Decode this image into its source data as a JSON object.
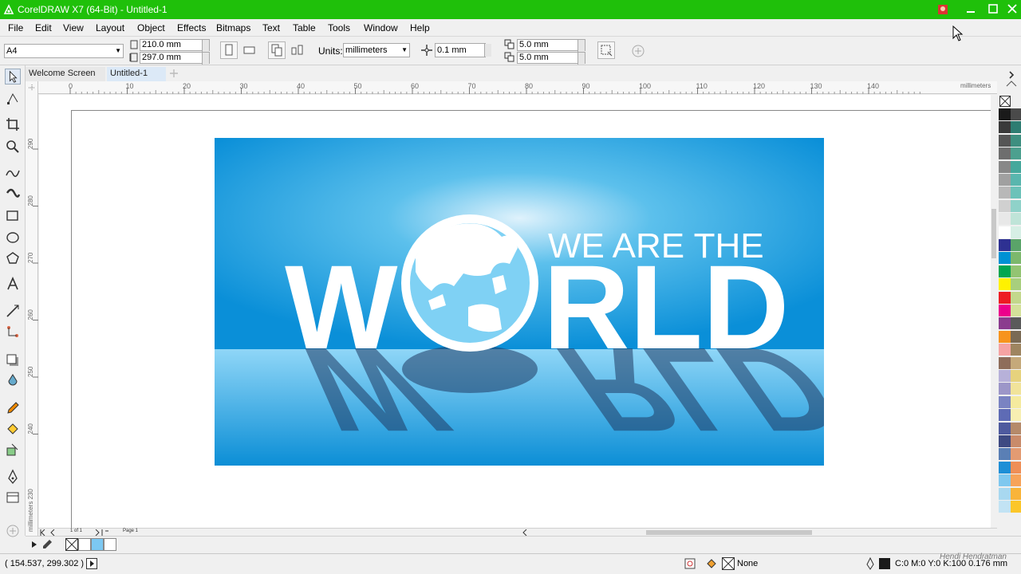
{
  "window": {
    "title": "CorelDRAW X7 (64-Bit) - Untitled-1",
    "titlebar_color": "#1fc00a"
  },
  "menu": [
    {
      "label": "File"
    },
    {
      "label": "Edit"
    },
    {
      "label": "View"
    },
    {
      "label": "Layout"
    },
    {
      "label": "Object"
    },
    {
      "label": "Effects"
    },
    {
      "label": "Bitmaps"
    },
    {
      "label": "Text"
    },
    {
      "label": "Table"
    },
    {
      "label": "Tools"
    },
    {
      "label": "Window"
    },
    {
      "label": "Help"
    }
  ],
  "propertybar": {
    "page_size": "A4",
    "width": "210.0 mm",
    "height": "297.0 mm",
    "units_label": "Units:",
    "units_value": "millimeters",
    "nudge": "0.1 mm",
    "dup_x": "5.0 mm",
    "dup_y": "5.0 mm"
  },
  "tabs": [
    {
      "label": "Welcome Screen"
    },
    {
      "label": "Untitled-1"
    }
  ],
  "ruler": {
    "h_ticks": [
      "0",
      "10",
      "20",
      "30",
      "40",
      "50",
      "60",
      "70",
      "80",
      "90",
      "100",
      "110",
      "120",
      "130",
      "140"
    ],
    "h_unit": "millimeters",
    "v_ticks": [
      "290",
      "280",
      "270",
      "260",
      "250",
      "240"
    ],
    "v_unit": "millimeters 230"
  },
  "artwork": {
    "line1": "WE ARE THE",
    "world_w": "W",
    "world_rest": "RLD",
    "bg_color": "#0a8fd8"
  },
  "page_nav": {
    "counter": "1 of 1",
    "page_label": "Page 1"
  },
  "status": {
    "coords": "( 154.537, 299.302 )",
    "fill_label": "None",
    "outline_info": "C:0 M:0 Y:0 K:100  0.176 mm",
    "watermark": "Hendi Hendratman"
  },
  "palette_colors": [
    [
      "#1a1a1a",
      "#4a4a4a"
    ],
    [
      "#3a3a3a",
      "#2e7d72"
    ],
    [
      "#555555",
      "#3d8f80"
    ],
    [
      "#6e6e6e",
      "#4ca08f"
    ],
    [
      "#888888",
      "#45a89c"
    ],
    [
      "#a0a0a0",
      "#59b6ae"
    ],
    [
      "#b8b8b8",
      "#6cc2b9"
    ],
    [
      "#d0d0d0",
      "#8fd2c9"
    ],
    [
      "#e8e8e8",
      "#bfe4d8"
    ],
    [
      "#ffffff",
      "#d6efe5"
    ],
    [
      "#2e3192",
      "#5aa469"
    ],
    [
      "#0091d4",
      "#7cb86c"
    ],
    [
      "#00a650",
      "#93c472"
    ],
    [
      "#fff200",
      "#a8cf7d"
    ],
    [
      "#ed1c24",
      "#c3d88c"
    ],
    [
      "#ec008c",
      "#d4e19a"
    ],
    [
      "#8b3c8e",
      "#5a5a5a"
    ],
    [
      "#f7941d",
      "#7a6a54"
    ],
    [
      "#f5a3a3",
      "#9e8560"
    ],
    [
      "#8e6d5a",
      "#c5a97a"
    ],
    [
      "#b7b1d9",
      "#e6d27d"
    ],
    [
      "#9c96c8",
      "#f1e39a"
    ],
    [
      "#7a83c2",
      "#f5ea9e"
    ],
    [
      "#5e6bb5",
      "#f7efb2"
    ],
    [
      "#4e5a9e",
      "#b58a6a"
    ],
    [
      "#3e4a82",
      "#c98b6a"
    ],
    [
      "#5a7fb5",
      "#e39b72"
    ],
    [
      "#1d8fd6",
      "#ef8f57"
    ],
    [
      "#7fc8ef",
      "#f7a35a"
    ],
    [
      "#a8d8f0",
      "#f9b43a"
    ],
    [
      "#c2e3f4",
      "#fbc62a"
    ]
  ],
  "dock_colors": [
    "#ffffff",
    "#7cc8f2",
    "#ffffff"
  ]
}
